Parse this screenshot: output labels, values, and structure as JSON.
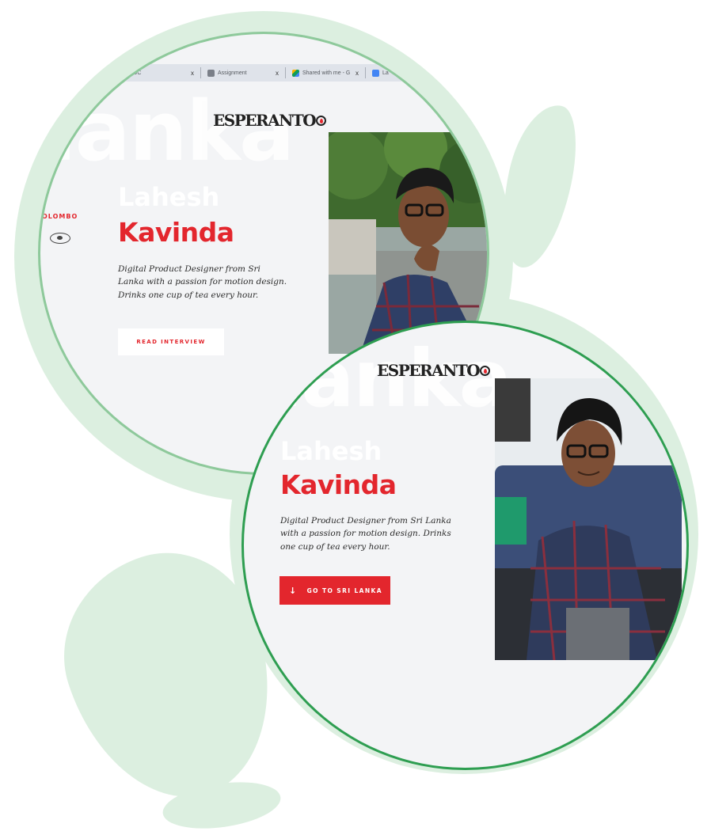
{
  "browser_tabs": [
    {
      "label": "...DOC",
      "icon": "doc-icon"
    },
    {
      "label": "Assignment",
      "icon": "people-icon"
    },
    {
      "label": "Shared with me - G",
      "icon": "drive-icon"
    },
    {
      "label": "La",
      "icon": "docs-icon"
    }
  ],
  "tab_close_glyph": "x",
  "logo": "ESPERANTO",
  "screen1": {
    "background_word": "lanka",
    "location_label": "OLOMBO",
    "first_name": "Lahesh",
    "last_name": "Kavinda",
    "bio": "Digital Product Designer from Sri Lanka with a passion for motion design. Drinks one cup of tea every hour.",
    "button_label": "READ INTERVIEW"
  },
  "screen2": {
    "background_word": "lanka",
    "first_name": "Lahesh",
    "last_name": "Kavinda",
    "bio": "Digital Product Designer from Sri Lanka with a passion for motion design. Drinks one cup of tea every hour.",
    "button_prefix": "GO TO",
    "button_strong": "SRI LANKA",
    "button_arrow": "↓"
  },
  "colors": {
    "accent_red": "#e3262d",
    "circle_green": "#2e9e51",
    "halo_green": "#dcefe0"
  }
}
